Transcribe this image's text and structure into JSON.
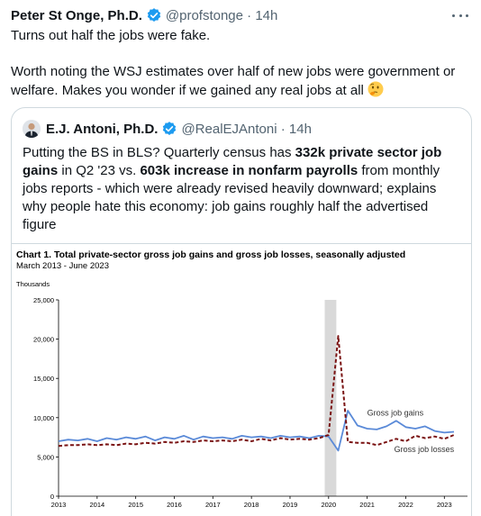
{
  "tweet": {
    "author_name": "Peter St Onge, Ph.D.",
    "handle": "@profstonge",
    "time": "14h",
    "lines": [
      "Turns out half the jobs were fake.",
      "Worth noting the WSJ estimates over half of new jobs were government or",
      "welfare. Makes you wonder if we gained any real jobs at all"
    ],
    "emoji": "thinking-face"
  },
  "quote": {
    "author_name": "E.J. Antoni, Ph.D.",
    "handle": "@RealEJAntoni",
    "time": "14h",
    "text": {
      "l1a": "Putting the BS in BLS? Quarterly census has ",
      "l1b": "332k private sector job",
      "l2a": "gains",
      "l2b": " in Q2 '23 vs. ",
      "l2c": "603k increase in nonfarm payrolls",
      "l2d": " from monthly",
      "l3": "jobs reports - which were already revised heavily downward; explains",
      "l4": "why people hate this economy: job gains roughly half the advertised",
      "l5": "figure"
    }
  },
  "colors": {
    "verified": "#1d9bf0",
    "gains_line": "#5a8ad8",
    "losses_line": "#7a1212",
    "recession_band": "#d9d9d9"
  },
  "chart_data": {
    "type": "line",
    "title": "Chart 1. Total private-sector gross job gains and gross job losses, seasonally adjusted",
    "subtitle": "March 2013 - June 2023",
    "units_label": "Thousands",
    "y_ticks": [
      "25,000",
      "20,000",
      "15,000",
      "10,000",
      "5,000",
      "0"
    ],
    "x_ticks": [
      "2013",
      "2014",
      "2015",
      "2016",
      "2017",
      "2018",
      "2019",
      "2020",
      "2021",
      "2022",
      "2023"
    ],
    "ylim": [
      0,
      25000
    ],
    "xlim": [
      2013,
      2023.6
    ],
    "shaded_region": [
      2019.9,
      2020.2
    ],
    "series": [
      {
        "name": "Gross job gains",
        "style": "solid",
        "x": [
          2013.0,
          2013.25,
          2013.5,
          2013.75,
          2014.0,
          2014.25,
          2014.5,
          2014.75,
          2015.0,
          2015.25,
          2015.5,
          2015.75,
          2016.0,
          2016.25,
          2016.5,
          2016.75,
          2017.0,
          2017.25,
          2017.5,
          2017.75,
          2018.0,
          2018.25,
          2018.5,
          2018.75,
          2019.0,
          2019.25,
          2019.5,
          2019.75,
          2020.0,
          2020.25,
          2020.5,
          2020.75,
          2021.0,
          2021.25,
          2021.5,
          2021.75,
          2022.0,
          2022.25,
          2022.5,
          2022.75,
          2023.0,
          2023.25
        ],
        "values": [
          7000,
          7200,
          7100,
          7300,
          7000,
          7400,
          7200,
          7500,
          7300,
          7600,
          7100,
          7500,
          7300,
          7700,
          7200,
          7600,
          7400,
          7500,
          7300,
          7700,
          7500,
          7600,
          7400,
          7700,
          7500,
          7600,
          7400,
          7700,
          7600,
          5800,
          10900,
          9000,
          8600,
          8500,
          8900,
          9600,
          8800,
          8600,
          8900,
          8300,
          8100,
          8200
        ]
      },
      {
        "name": "Gross job losses",
        "style": "dashed",
        "x": [
          2013.0,
          2013.25,
          2013.5,
          2013.75,
          2014.0,
          2014.25,
          2014.5,
          2014.75,
          2015.0,
          2015.25,
          2015.5,
          2015.75,
          2016.0,
          2016.25,
          2016.5,
          2016.75,
          2017.0,
          2017.25,
          2017.5,
          2017.75,
          2018.0,
          2018.25,
          2018.5,
          2018.75,
          2019.0,
          2019.25,
          2019.5,
          2019.75,
          2020.0,
          2020.25,
          2020.5,
          2020.75,
          2021.0,
          2021.25,
          2021.5,
          2021.75,
          2022.0,
          2022.25,
          2022.5,
          2022.75,
          2023.0,
          2023.25
        ],
        "values": [
          6400,
          6500,
          6500,
          6600,
          6500,
          6600,
          6500,
          6700,
          6600,
          6800,
          6700,
          6900,
          6800,
          7000,
          6900,
          7100,
          7000,
          7100,
          7000,
          7200,
          7000,
          7300,
          7100,
          7400,
          7200,
          7300,
          7200,
          7400,
          7800,
          20400,
          6900,
          6800,
          6800,
          6500,
          6900,
          7300,
          7000,
          7700,
          7400,
          7600,
          7300,
          7800
        ]
      }
    ]
  }
}
